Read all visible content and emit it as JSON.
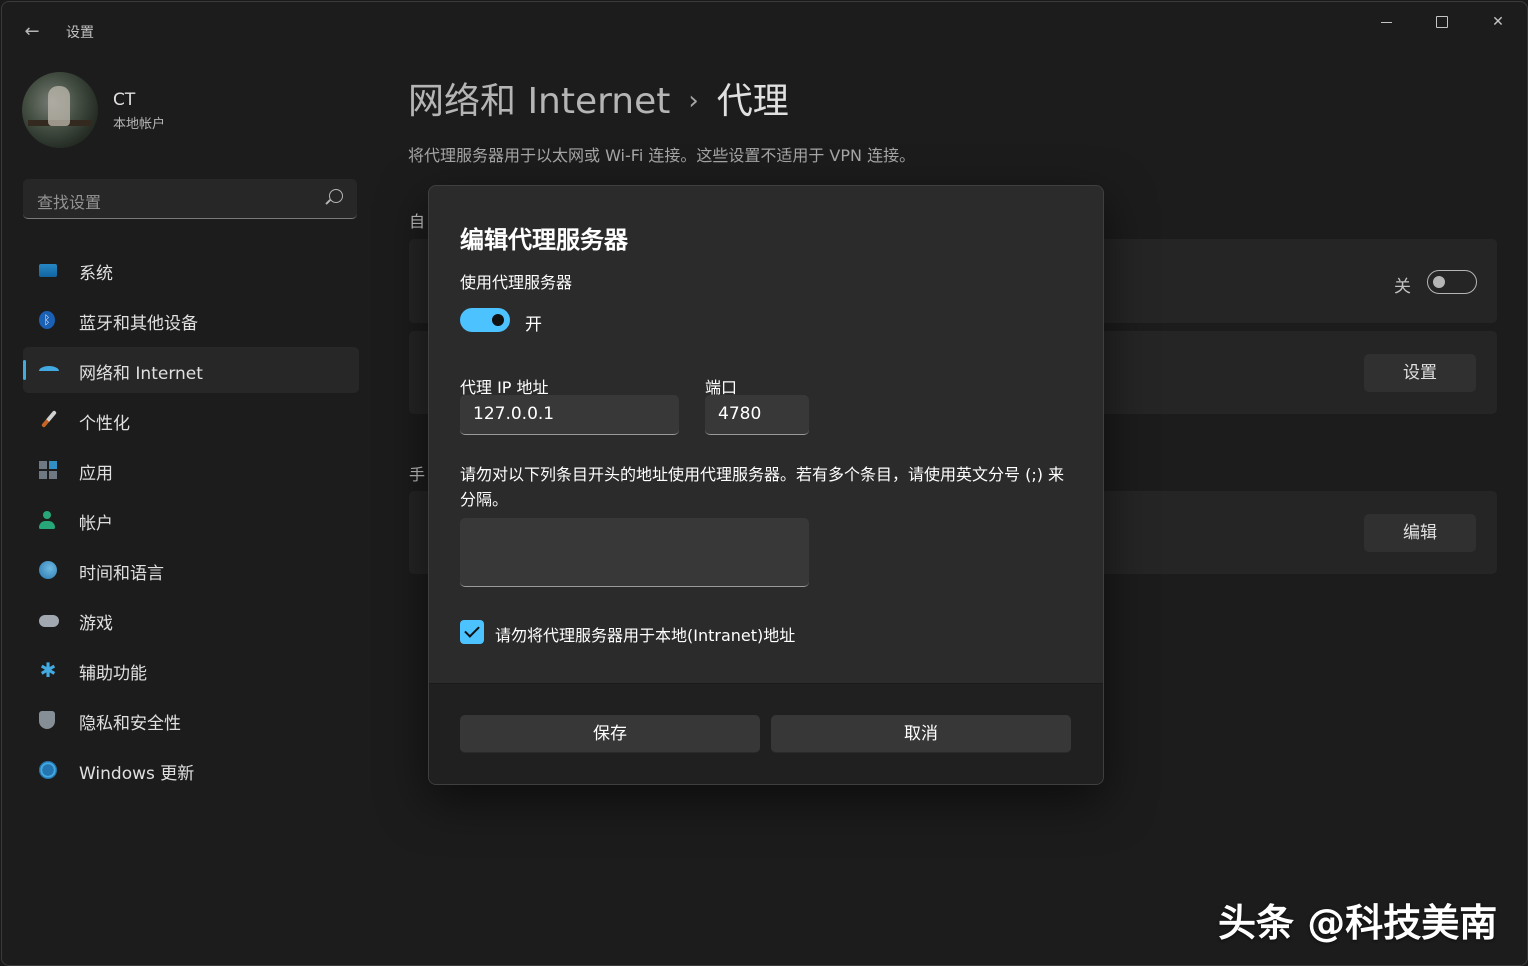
{
  "titlebar": {
    "title": "设置",
    "back_icon": "←",
    "min_icon": "minimize-icon",
    "max_icon": "maximize-icon",
    "close_icon": "✕"
  },
  "user": {
    "name": "CT",
    "account_type": "本地帐户"
  },
  "search": {
    "placeholder": "查找设置"
  },
  "sidebar": {
    "items": [
      {
        "label": "系统",
        "icon": "system-icon"
      },
      {
        "label": "蓝牙和其他设备",
        "icon": "bluetooth-icon"
      },
      {
        "label": "网络和 Internet",
        "icon": "network-icon",
        "active": true
      },
      {
        "label": "个性化",
        "icon": "brush-icon"
      },
      {
        "label": "应用",
        "icon": "apps-icon"
      },
      {
        "label": "帐户",
        "icon": "account-icon"
      },
      {
        "label": "时间和语言",
        "icon": "time-language-icon"
      },
      {
        "label": "游戏",
        "icon": "game-icon"
      },
      {
        "label": "辅助功能",
        "icon": "accessibility-icon"
      },
      {
        "label": "隐私和安全性",
        "icon": "shield-icon"
      },
      {
        "label": "Windows 更新",
        "icon": "update-icon"
      }
    ]
  },
  "page": {
    "breadcrumb_parent": "网络和 Internet",
    "breadcrumb_sep": "›",
    "breadcrumb_current": "代理",
    "description": "将代理服务器用于以太网或 Wi-Fi 连接。这些设置不适用于 VPN 连接。",
    "section_auto": "自",
    "section_manual": "手",
    "auto_toggle_label": "关",
    "setup_button": "设置",
    "edit_button": "编辑"
  },
  "dialog": {
    "title": "编辑代理服务器",
    "use_proxy_label": "使用代理服务器",
    "toggle_state": "开",
    "ip_label": "代理 IP 地址",
    "ip_value": "127.0.0.1",
    "port_label": "端口",
    "port_value": "4780",
    "exceptions_text": "请勿对以下列条目开头的地址使用代理服务器。若有多个条目，请使用英文分号 (;) 来分隔。",
    "exceptions_value": "",
    "local_checkbox_label": "请勿将代理服务器用于本地(Intranet)地址",
    "local_checkbox_checked": true,
    "save_button": "保存",
    "cancel_button": "取消"
  },
  "watermark": "头条 @科技美南",
  "colors": {
    "accent": "#4cc2ff",
    "background": "#202020",
    "card": "#2b2b2b"
  }
}
